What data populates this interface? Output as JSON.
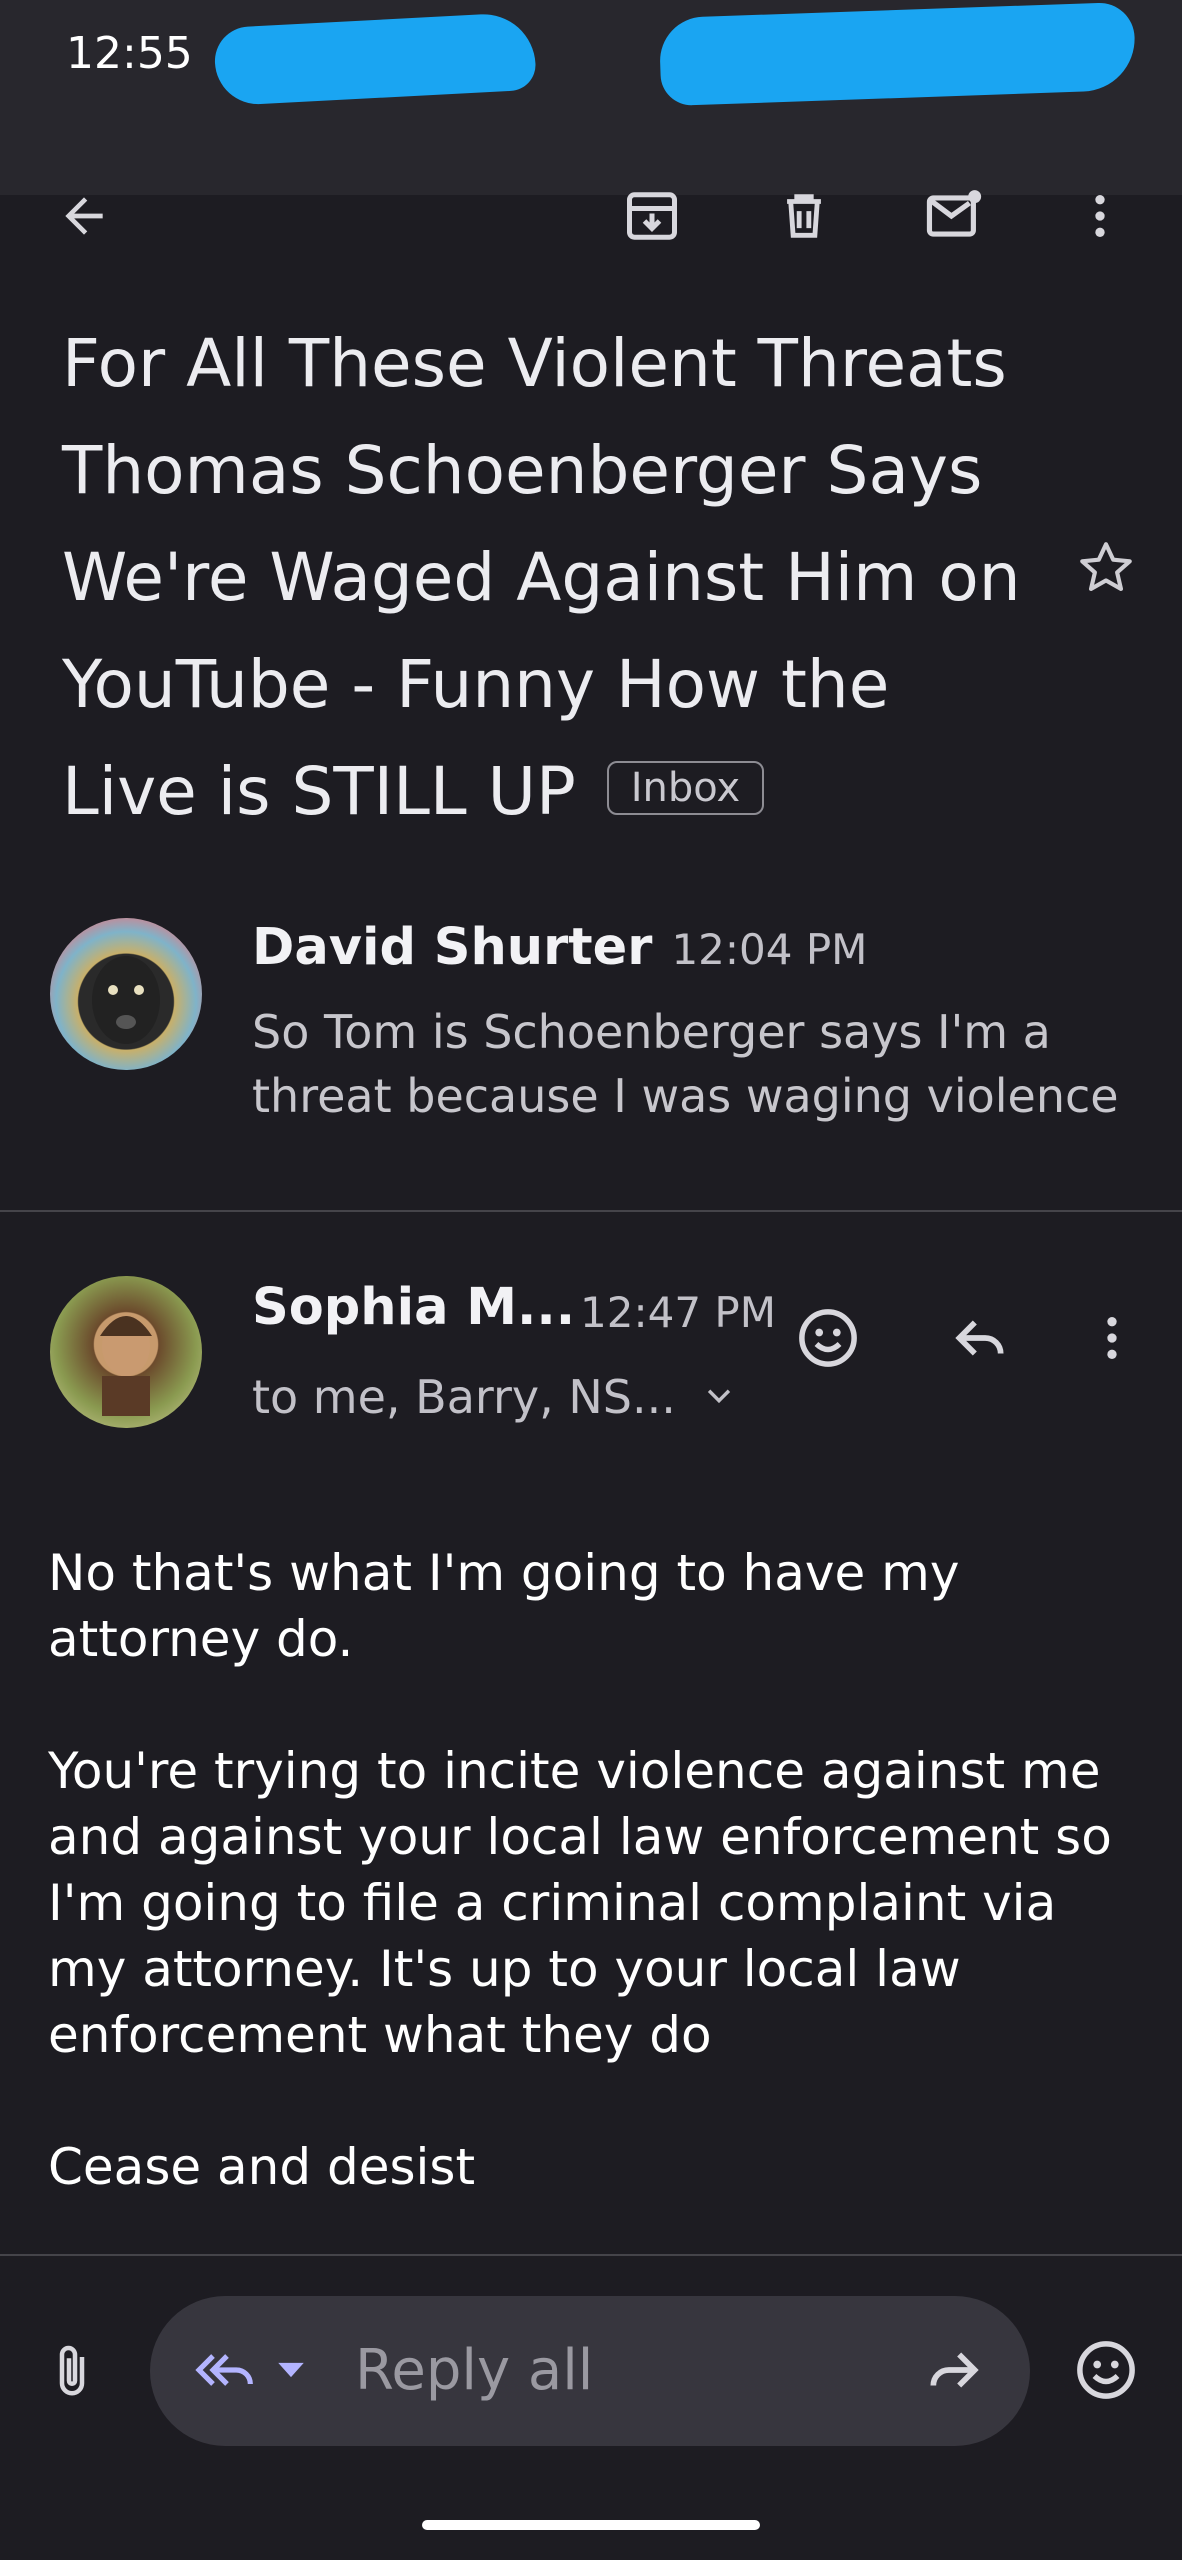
{
  "status_bar": {
    "time": "12:55"
  },
  "toolbar": {
    "back": "back-arrow-icon",
    "archive": "archive-icon",
    "delete": "trash-icon",
    "mark_unread": "mark-unread-icon",
    "more": "more-vert-icon"
  },
  "email": {
    "subject": "For All These Violent Threats Thomas Schoenberger Says We're Waged Against Him on YouTube - Funny How the Live is STILL UP",
    "label": "Inbox"
  },
  "messages": [
    {
      "sender": "David Shurter",
      "time": "12:04 PM",
      "snippet": "So Tom is Schoenberger says I'm a threat because I was waging violence"
    },
    {
      "sender": "Sophia M...",
      "time": "12:47 PM",
      "recipients": "to me, Barry, NS...",
      "body": [
        "No that's what I'm going to have my attorney do.",
        "You're trying to incite violence against me and against your local law enforcement so I'm going to file a criminal complaint via my attorney. It's up to your local law enforcement what they do",
        "Cease and desist"
      ]
    }
  ],
  "reply_bar": {
    "placeholder": "Reply all"
  },
  "colors": {
    "background": "#1d1c22",
    "toolbar": "#28272d",
    "reply_accent": "#b3b4ff",
    "redaction": "#1aa5f2"
  }
}
